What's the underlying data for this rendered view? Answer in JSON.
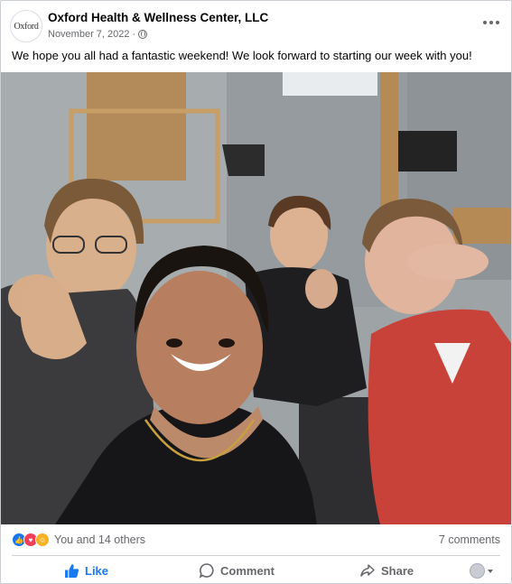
{
  "post": {
    "page_name": "Oxford Health & Wellness Center, LLC",
    "logo_text": "Oxford",
    "date": "November 7, 2022",
    "separator": "·",
    "privacy_icon": "globe-icon",
    "more_icon": "more-options-icon",
    "text": "We hope you all had a fantastic weekend! We look forward to starting our week with you!"
  },
  "engagement": {
    "reaction_icons": [
      "like-reaction-icon",
      "love-reaction-icon",
      "haha-reaction-icon"
    ],
    "reaction_text": "You and 14 others",
    "comments_text": "7 comments"
  },
  "actions": {
    "like_label": "Like",
    "comment_label": "Comment",
    "share_label": "Share"
  },
  "colors": {
    "like_blue": "#1877f2",
    "secondary_text": "#65676b",
    "love_red": "#f33e58",
    "haha_yellow": "#f7b125"
  }
}
